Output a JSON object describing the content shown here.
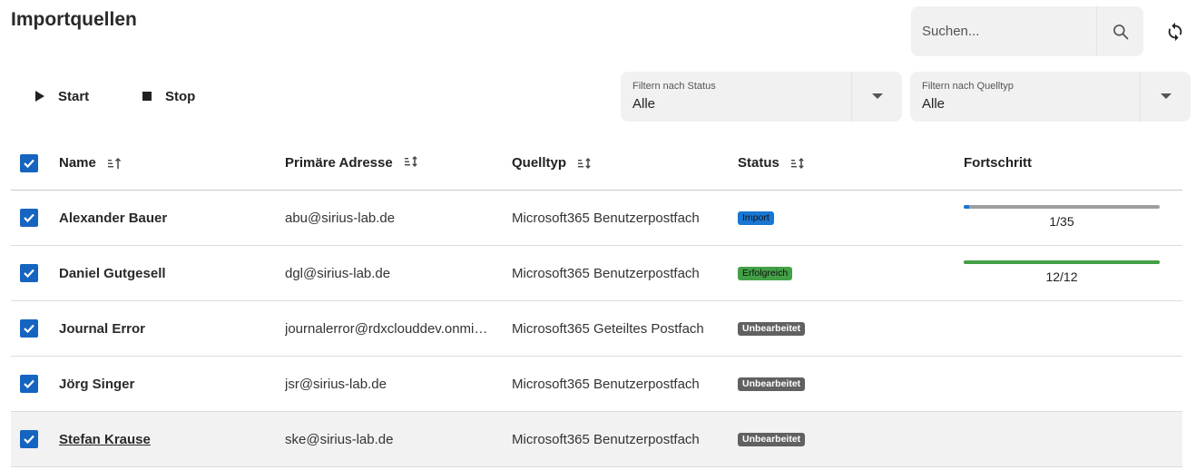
{
  "page": {
    "title": "Importquellen"
  },
  "search": {
    "placeholder": "Suchen..."
  },
  "actions": {
    "start_label": "Start",
    "stop_label": "Stop"
  },
  "filters": {
    "status": {
      "label": "Filtern nach Status",
      "value": "Alle"
    },
    "type": {
      "label": "Filtern nach Quelltyp",
      "value": "Alle"
    }
  },
  "table": {
    "headers": {
      "name": "Name",
      "address": "Primäre Adresse",
      "type": "Quelltyp",
      "status": "Status",
      "progress": "Fortschritt"
    },
    "rows": [
      {
        "name": "Alexander Bauer",
        "address": "abu@sirius-lab.de",
        "type": "Microsoft365 Benutzerpostfach",
        "status": "Import",
        "progress_text": "1/35",
        "progress": 0.029
      },
      {
        "name": "Daniel Gutgesell",
        "address": "dgl@sirius-lab.de",
        "type": "Microsoft365 Benutzerpostfach",
        "status": "Erfolgreich",
        "progress_text": "12/12",
        "progress": 1.0
      },
      {
        "name": "Journal Error",
        "address": "journalerror@rdxclouddev.onmi…",
        "type": "Microsoft365 Geteiltes Postfach",
        "status": "Unbearbeitet"
      },
      {
        "name": "Jörg Singer",
        "address": "jsr@sirius-lab.de",
        "type": "Microsoft365 Benutzerpostfach",
        "status": "Unbearbeitet"
      },
      {
        "name": "Stefan Krause",
        "address": "ske@sirius-lab.de",
        "type": "Microsoft365 Benutzerpostfach",
        "status": "Unbearbeitet"
      }
    ]
  },
  "colors": {
    "accent": "#1565c0",
    "import": "#1976d2",
    "success": "#43a047",
    "unprocessed": "#616161"
  }
}
